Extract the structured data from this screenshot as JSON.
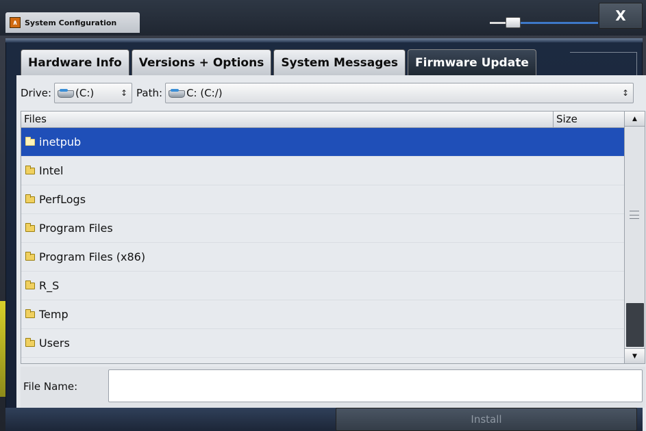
{
  "window": {
    "title": "System Configuration",
    "close_label": "X"
  },
  "tabs": [
    {
      "label": "Hardware Info",
      "active": false
    },
    {
      "label": "Versions + Options",
      "active": false
    },
    {
      "label": "System Messages",
      "active": false
    },
    {
      "label": "Firmware Update",
      "active": true
    }
  ],
  "drive": {
    "label": "Drive:",
    "value": "(C:)"
  },
  "path": {
    "label": "Path:",
    "value": "C: (C:/)"
  },
  "file_list": {
    "headers": {
      "files": "Files",
      "size": "Size"
    },
    "rows": [
      {
        "name": "inetpub",
        "selected": true
      },
      {
        "name": "Intel",
        "selected": false
      },
      {
        "name": "PerfLogs",
        "selected": false
      },
      {
        "name": "Program Files",
        "selected": false
      },
      {
        "name": "Program Files (x86)",
        "selected": false
      },
      {
        "name": "R_S",
        "selected": false
      },
      {
        "name": "Temp",
        "selected": false
      },
      {
        "name": "Users",
        "selected": false
      }
    ]
  },
  "filename": {
    "label": "File Name:",
    "value": ""
  },
  "actions": {
    "install_label": "Install"
  },
  "colors": {
    "selection": "#1f4fb8",
    "active_tab": "#2a3440",
    "panel": "#e6e9ed"
  }
}
